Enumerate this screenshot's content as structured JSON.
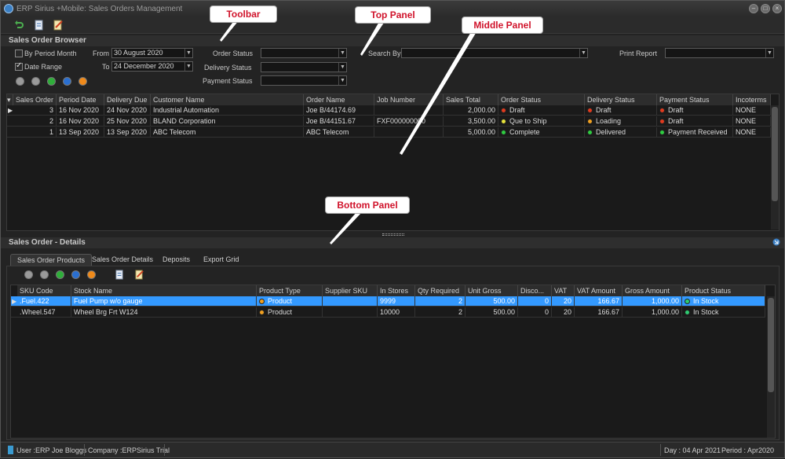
{
  "window": {
    "title": "ERP Sirius +Mobile: Sales Orders Management"
  },
  "callouts": {
    "toolbar": "Toolbar",
    "top_panel": "Top Panel",
    "middle_panel": "Middle Panel",
    "bottom_panel": "Bottom Panel"
  },
  "browser": {
    "title": "Sales Order Browser",
    "by_period_month": "By Period Month",
    "date_range": "Date Range",
    "from_label": "From",
    "from_value": "30 August 2020",
    "to_label": "To",
    "to_value": "24 December 2020",
    "order_status_label": "Order Status",
    "delivery_status_label": "Delivery Status",
    "payment_status_label": "Payment Status",
    "search_by_label": "Search By",
    "print_report_label": "Print Report"
  },
  "orders": {
    "columns": [
      "Sales Order",
      "Period Date",
      "Delivery Due",
      "Customer Name",
      "Order Name",
      "Job Number",
      "Sales Total",
      "Order Status",
      "Delivery Status",
      "Payment Status",
      "Incoterms"
    ],
    "rows": [
      {
        "so": "3",
        "period": "16 Nov 2020",
        "due": "24 Nov 2020",
        "customer": "Industrial Automation",
        "order_name": "Joe B/44174.69",
        "job": "",
        "total": "2,000.00",
        "order_status": "Draft",
        "order_color": "#e03a1e",
        "delivery": "Draft",
        "delivery_color": "#e03a1e",
        "payment": "Draft",
        "payment_color": "#e03a1e",
        "incoterms": "NONE"
      },
      {
        "so": "2",
        "period": "16 Nov 2020",
        "due": "25 Nov 2020",
        "customer": "BLAND Corporation",
        "order_name": "Joe B/44151.67",
        "job": "FXF000000000",
        "total": "3,500.00",
        "order_status": "Que to Ship",
        "order_color": "#e6e23a",
        "delivery": "Loading",
        "delivery_color": "#f0a020",
        "payment": "Draft",
        "payment_color": "#e03a1e",
        "incoterms": "NONE"
      },
      {
        "so": "1",
        "period": "13 Sep 2020",
        "due": "13 Sep 2020",
        "customer": "ABC Telecom",
        "order_name": "ABC Telecom",
        "job": "",
        "total": "5,000.00",
        "order_status": "Complete",
        "order_color": "#2ecc40",
        "delivery": "Delivered",
        "delivery_color": "#2ecc40",
        "payment": "Payment Received",
        "payment_color": "#2ecc40",
        "incoterms": "NONE"
      }
    ]
  },
  "details": {
    "title": "Sales Order - Details",
    "tabs": [
      "Sales Order Products",
      "Sales Order Details",
      "Deposits",
      "Export Grid"
    ],
    "columns": [
      "SKU Code",
      "Stock Name",
      "Product Type",
      "Supplier SKU",
      "In Stores",
      "Qty Required",
      "Unit Gross",
      "Disco...",
      "VAT",
      "VAT Amount",
      "Gross Amount",
      "Product Status"
    ],
    "rows": [
      {
        "sku": ".Fuel.422",
        "name": "Fuel Pump w/o gauge",
        "type": "Product",
        "supplier": "",
        "stores": "9999",
        "qty": "2",
        "unit": "500.00",
        "disc": "0",
        "vat": "20",
        "vat_amt": "166.67",
        "gross": "1,000.00",
        "status": "In Stock",
        "selected": true
      },
      {
        "sku": ".Wheel.547",
        "name": "Wheel Brg Frt W124",
        "type": "Product",
        "supplier": "",
        "stores": "10000",
        "qty": "2",
        "unit": "500.00",
        "disc": "0",
        "vat": "20",
        "vat_amt": "166.67",
        "gross": "1,000.00",
        "status": "In Stock",
        "selected": false
      }
    ]
  },
  "status": {
    "user": "User :ERP Joe Bloggs",
    "company": "Company :ERPSirius Trial",
    "day": "Day : 04 Apr 2021",
    "period": "Period : Apr2020"
  }
}
